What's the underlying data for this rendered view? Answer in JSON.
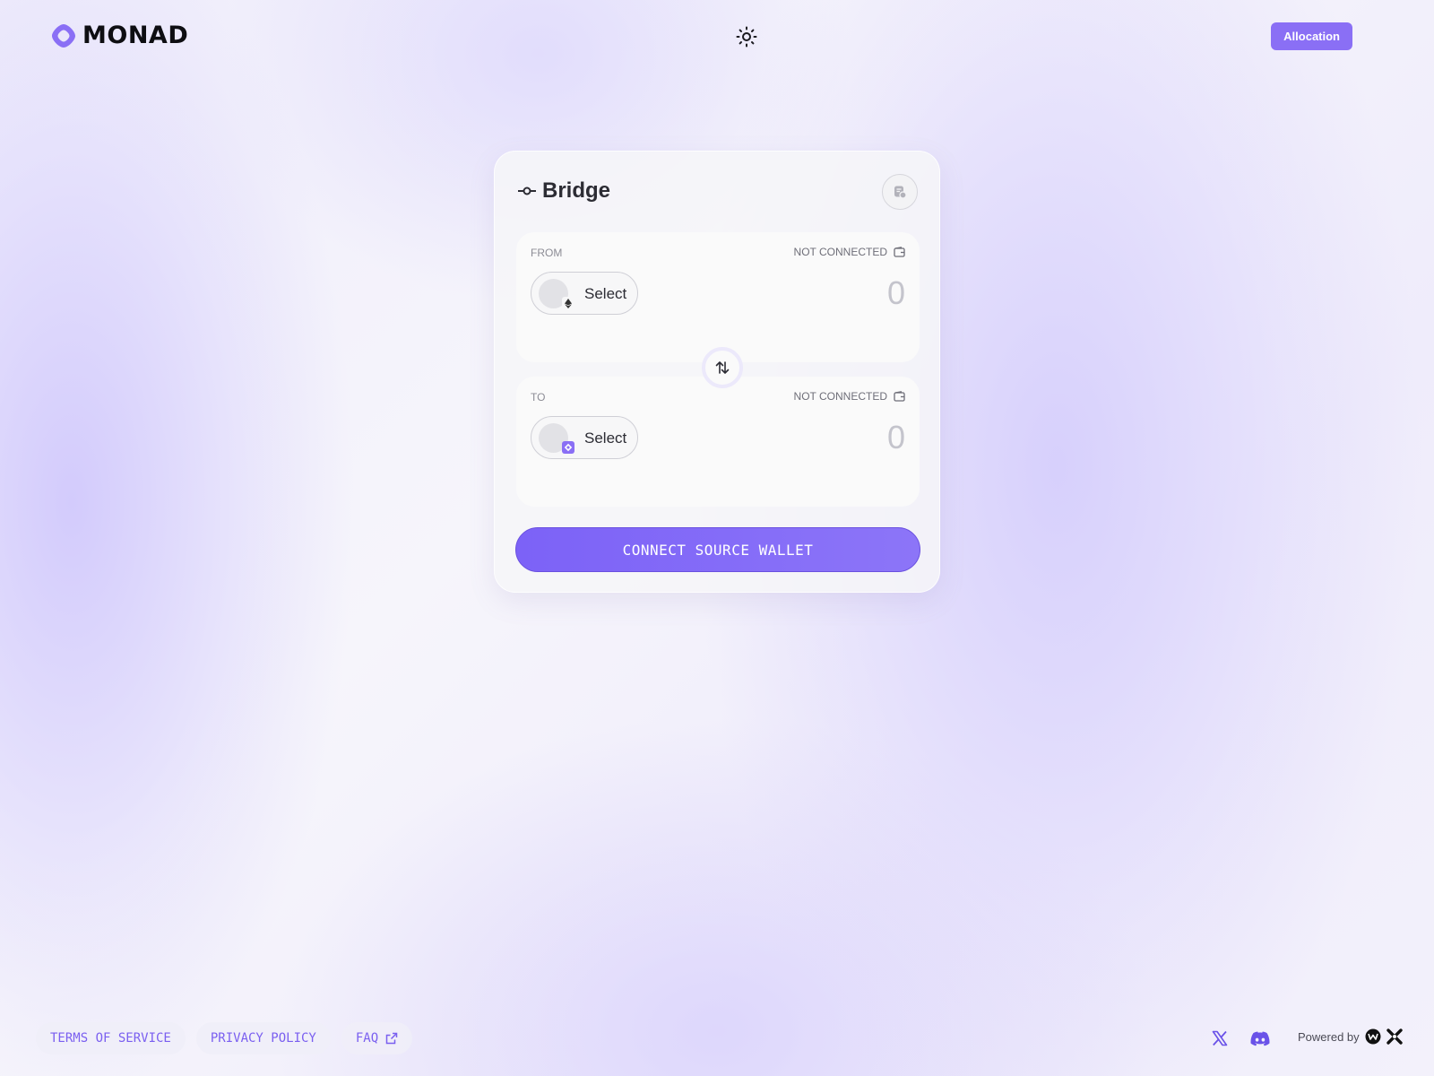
{
  "header": {
    "logo_text": "MONAD",
    "theme_icon": "sun-icon",
    "allocation_label": "Allocation"
  },
  "bridge": {
    "title": "Bridge",
    "title_icon": "commit-icon",
    "history_icon": "history-icon",
    "from": {
      "label": "FROM",
      "status": "NOT CONNECTED",
      "wallet_icon": "wallet-icon",
      "select_label": "Select",
      "chain_icon": "ethereum-icon",
      "amount": "0"
    },
    "to": {
      "label": "TO",
      "status": "NOT CONNECTED",
      "wallet_icon": "wallet-icon",
      "select_label": "Select",
      "chain_icon": "monad-icon",
      "amount": "0"
    },
    "swap_icon": "swap-arrows-icon",
    "connect_label": "CONNECT SOURCE WALLET"
  },
  "footer": {
    "links": [
      {
        "label": "TERMS OF SERVICE"
      },
      {
        "label": "PRIVACY POLICY"
      },
      {
        "label": "FAQ",
        "icon": "external-link-icon"
      }
    ],
    "social": [
      "x-icon",
      "discord-icon"
    ],
    "powered_by": "Powered by"
  },
  "colors": {
    "accent": "#8a6ff5",
    "button_gradient_start": "#7c62f7",
    "link": "#7a5ff0"
  }
}
